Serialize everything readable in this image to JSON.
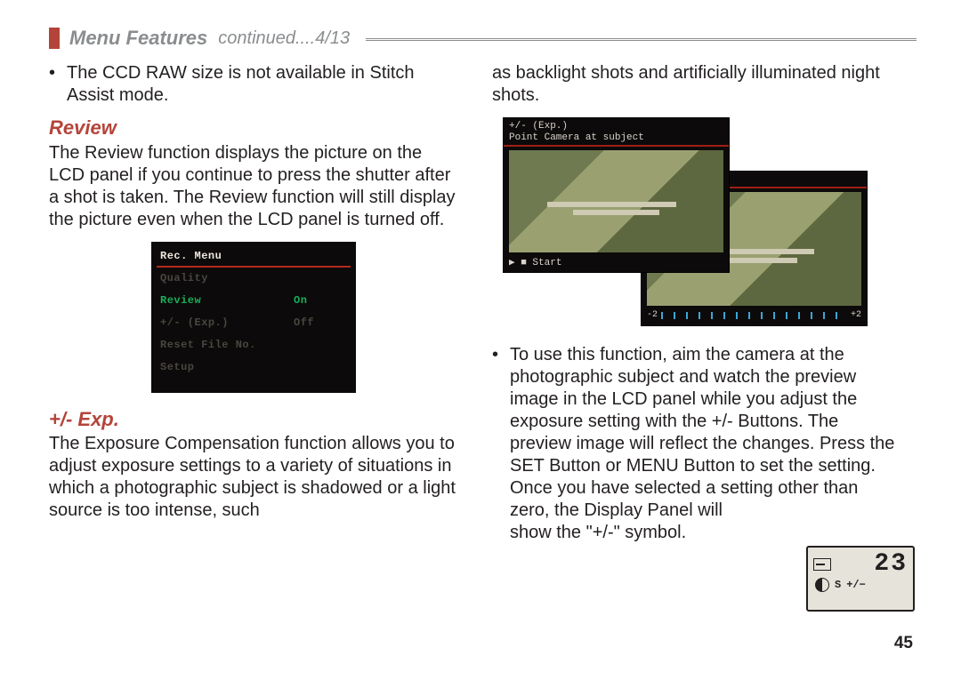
{
  "header": {
    "title": "Menu Features",
    "continued": "continued....4/13"
  },
  "left": {
    "bullet1": "The CCD RAW size is not available in Stitch Assist mode.",
    "h_review": "Review",
    "p_review": "The Review function displays the picture on the LCD panel if you continue to press the shutter after a shot is taken. The Review function will still display the picture even when the LCD panel is turned off.",
    "h_exp": "+/- Exp.",
    "p_exp": "The Exposure Compensation function allows you to adjust exposure settings to a variety of situations in which a photographic subject is shadowed or a light source is too intense, such"
  },
  "right": {
    "p_top": "as backlight shots and artificially illuminated night shots.",
    "bullet1a": "To use this function, aim the camera at the photographic subject and watch the preview image in the LCD panel while you adjust the exposure setting with the +/- Buttons. The preview image will reflect the changes. Press the SET Button or MENU Button to set the setting. Once you have selected a setting other than zero, the Display Panel will",
    "bullet1b": "show the \"+/-\" symbol."
  },
  "rec_menu": {
    "title": "Rec. Menu",
    "rows": [
      {
        "label": "Quality",
        "value": ""
      },
      {
        "label": "Review",
        "value": "On"
      },
      {
        "label": "+/- (Exp.)",
        "value": "Off"
      },
      {
        "label": "Reset File No.",
        "value": ""
      },
      {
        "label": "Setup",
        "value": ""
      }
    ]
  },
  "exp_screen": {
    "line1": "+/- (Exp.)",
    "line2": "Point Camera at subject",
    "start": "▶ ■ Start",
    "scale_min": "-2",
    "scale_max": "+2"
  },
  "display_panel": {
    "number": "23",
    "mode_s": "S",
    "plusminus": "+/−"
  },
  "page_number": "45"
}
